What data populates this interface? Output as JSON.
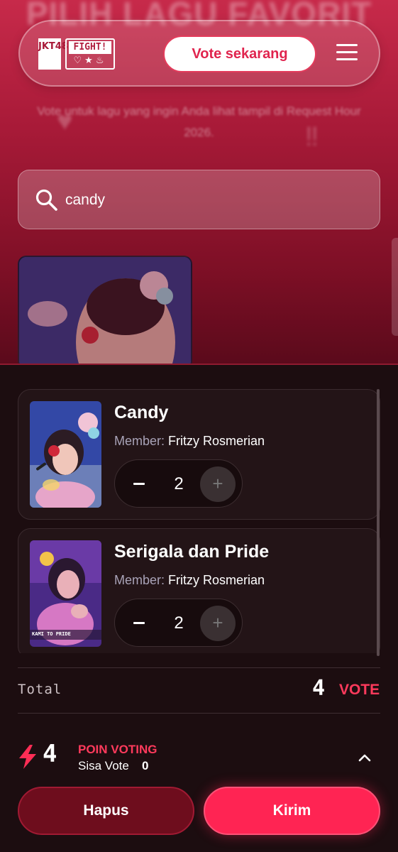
{
  "background_page": {
    "title": "PILIH LAGU FAVORIT",
    "subtitle": "Vote untuk lagu yang ingin Anda lihat tampil di Request Hour 2026."
  },
  "header": {
    "logo_jkt": "JKT48",
    "logo_fight": "FIGHT!",
    "logo_fight_symbols": "♡★♨",
    "vote_button": "Vote sekarang",
    "menu_icon": "hamburger-menu-icon"
  },
  "search": {
    "value": "candy",
    "icon": "search-icon"
  },
  "cart": {
    "items": [
      {
        "title": "Candy",
        "member_label": "Member:",
        "member": "Fritzy Rosmerian",
        "quantity": "2"
      },
      {
        "title": "Serigala dan Pride",
        "member_label": "Member:",
        "member": "Fritzy Rosmerian",
        "quantity": "2",
        "thumb_caption": "KAMI TO PRIDE"
      }
    ]
  },
  "total": {
    "label": "Total",
    "count": "4",
    "unit": "VOTE"
  },
  "points": {
    "count": "4",
    "label": "POIN VOTING",
    "remaining_label": "Sisa Vote",
    "remaining_value": "0"
  },
  "actions": {
    "delete": "Hapus",
    "submit": "Kirim"
  },
  "colors": {
    "accent": "#ff2453",
    "accent_text": "#ff3a5c",
    "header_red": "#c72a4a",
    "sheet_bg": "#1c0d10"
  }
}
